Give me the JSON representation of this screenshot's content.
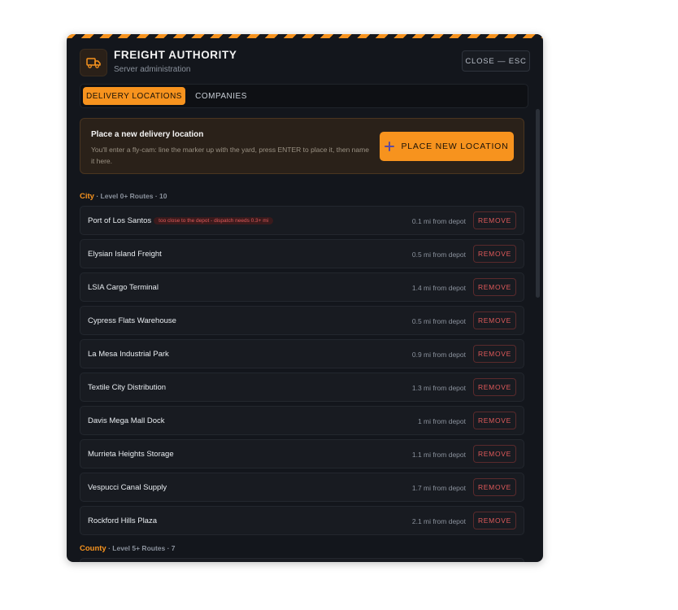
{
  "header": {
    "title": "FREIGHT AUTHORITY",
    "subtitle": "Server administration",
    "close_label": "CLOSE — ESC",
    "logo_icon": "truck-icon"
  },
  "tabs": [
    {
      "label": "DELIVERY LOCATIONS",
      "active": true
    },
    {
      "label": "COMPANIES",
      "active": false
    }
  ],
  "place": {
    "title": "Place a new delivery location",
    "description": "You'll enter a fly-cam: line the marker up with the yard, press ENTER to place it, then name it here.",
    "button_label": "PLACE NEW LOCATION",
    "button_icon": "plus-icon"
  },
  "sections": [
    {
      "name": "City",
      "meta": "· Level 0+ Routes · 10"
    },
    {
      "name": "County",
      "meta": "· Level 5+ Routes · 7"
    }
  ],
  "locations": [
    {
      "name": "Port of Los Santos",
      "badge": "too close to the depot - dispatch needs 0.3+ mi",
      "distance": "0.1 mi from depot"
    },
    {
      "name": "Elysian Island Freight",
      "distance": "0.5 mi from depot"
    },
    {
      "name": "LSIA Cargo Terminal",
      "distance": "1.4 mi from depot"
    },
    {
      "name": "Cypress Flats Warehouse",
      "distance": "0.5 mi from depot"
    },
    {
      "name": "La Mesa Industrial Park",
      "distance": "0.9 mi from depot"
    },
    {
      "name": "Textile City Distribution",
      "distance": "1.3 mi from depot"
    },
    {
      "name": "Davis Mega Mall Dock",
      "distance": "1 mi from depot"
    },
    {
      "name": "Murrieta Heights Storage",
      "distance": "1.1 mi from depot"
    },
    {
      "name": "Vespucci Canal Supply",
      "distance": "1.7 mi from depot"
    },
    {
      "name": "Rockford Hills Plaza",
      "distance": "2.1 mi from depot"
    }
  ],
  "remove_label": "REMOVE",
  "colors": {
    "accent": "#f7931e",
    "danger": "#e05a5a",
    "panel": "#13161c"
  }
}
